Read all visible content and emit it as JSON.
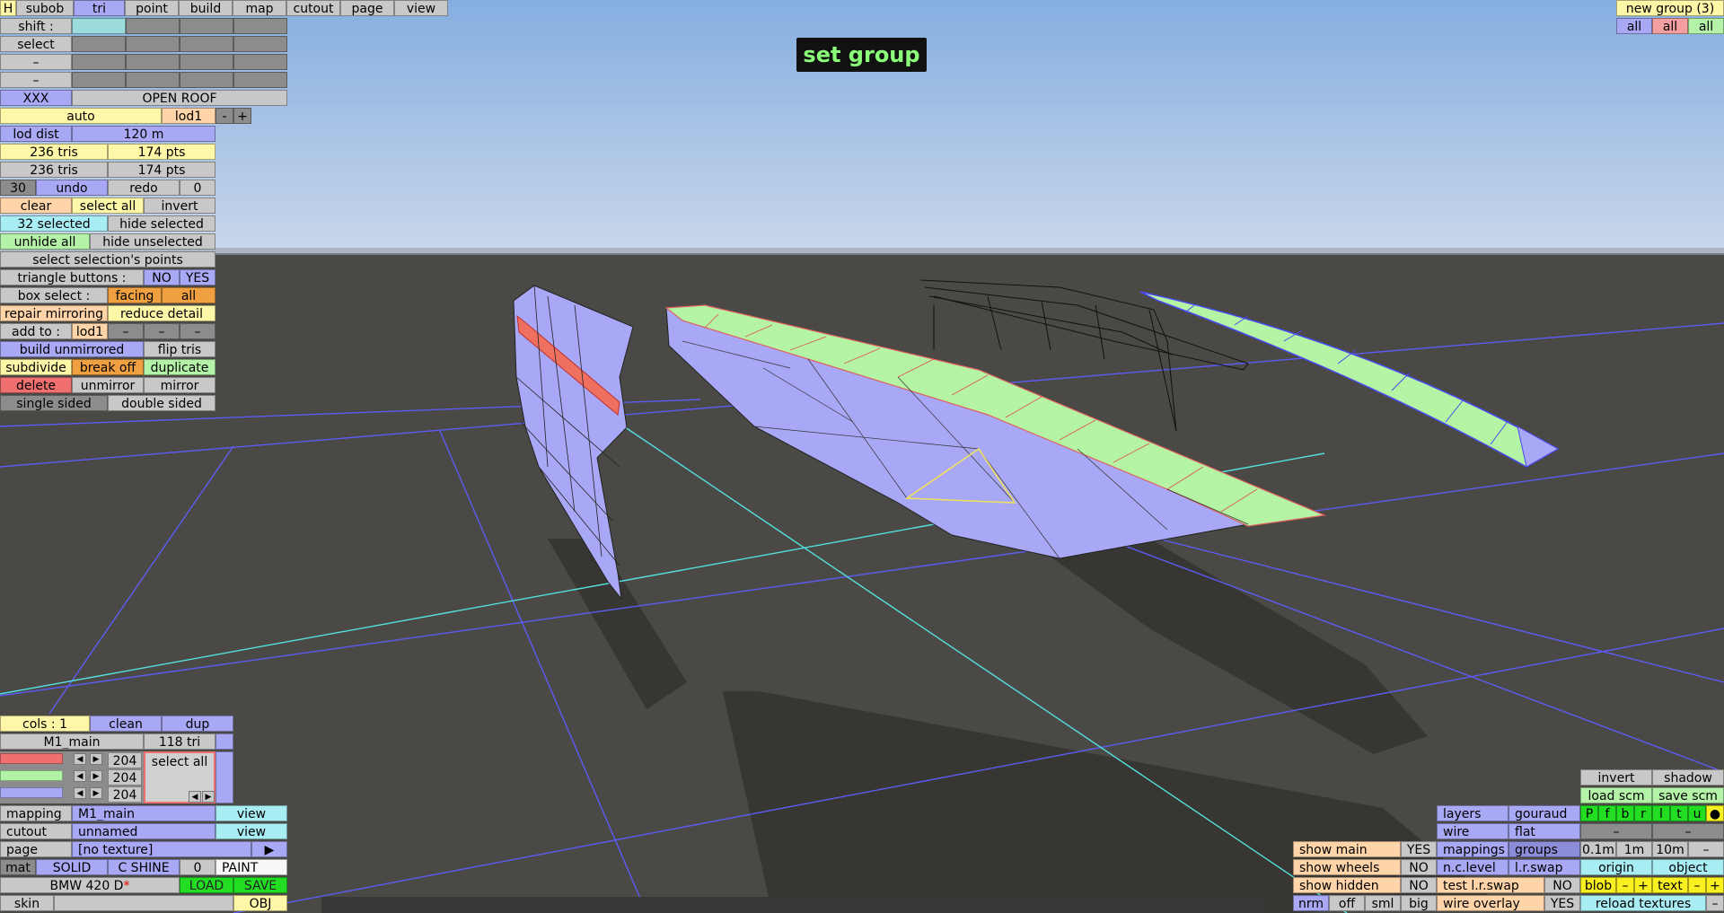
{
  "overlay": {
    "title": "set group"
  },
  "top_tabs": [
    "H",
    "subob",
    "tri",
    "point",
    "build",
    "map",
    "cutout",
    "page",
    "view"
  ],
  "panel": {
    "shift_label": "shift :",
    "select_label": "select",
    "dash": "–",
    "xxx": "XXX",
    "open_roof": "OPEN ROOF",
    "auto": "auto",
    "lod": "lod1",
    "minus": "-",
    "plus": "+",
    "lod_dist_label": "lod dist",
    "lod_dist_value": "120 m",
    "tris1": "236 tris",
    "pts1": "174 pts",
    "tris2": "236 tris",
    "pts2": "174 pts",
    "undo_count": "30",
    "undo": "undo",
    "redo": "redo",
    "redo_count": "0",
    "clear": "clear",
    "select_all": "select all",
    "invert": "invert",
    "selected_count": "32 selected",
    "hide_selected": "hide selected",
    "unhide_all": "unhide all",
    "hide_unselected": "hide unselected",
    "select_points": "select selection's points",
    "triangle_buttons": "triangle buttons :",
    "no": "NO",
    "yes": "YES",
    "box_select": "box select :",
    "facing": "facing",
    "all": "all",
    "repair_mirroring": "repair mirroring",
    "reduce_detail": "reduce detail",
    "add_to": "add to :",
    "add_lod": "lod1",
    "build_unmirrored": "build unmirrored",
    "flip_tris": "flip tris",
    "subdivide": "subdivide",
    "break_off": "break off",
    "duplicate": "duplicate",
    "delete": "delete",
    "unmirror": "unmirror",
    "mirror": "mirror",
    "single_sided": "single sided",
    "double_sided": "double sided"
  },
  "bottom_left": {
    "cols": "cols : 1",
    "clean": "clean",
    "dup": "dup",
    "material": "M1_main",
    "mat_tri": "118 tri",
    "rgb_values": [
      "204",
      "204",
      "204"
    ],
    "select_all": "select all",
    "mapping_label": "mapping",
    "mapping_value": "M1_main",
    "view": "view",
    "cutout_label": "cutout",
    "cutout_value": "unnamed",
    "page_label": "page",
    "page_value": "[no texture]",
    "play": "▶",
    "mat": "mat",
    "solid": "SOLID",
    "c_shine": "C SHINE",
    "shine_value": "0",
    "paint": "PAINT",
    "model_name": "BMW 420 D",
    "modified_mark": "*",
    "load": "LOAD",
    "save": "SAVE",
    "skin": "skin",
    "obj": "OBJ"
  },
  "top_right": {
    "group": "new group (3)",
    "all": [
      "all",
      "all",
      "all"
    ]
  },
  "bottom_right": {
    "show_main": "show main",
    "show_main_v": "YES",
    "show_wheels": "show wheels",
    "show_wheels_v": "NO",
    "show_hidden": "show hidden",
    "show_hidden_v": "NO",
    "nrm": "nrm",
    "off": "off",
    "sml": "sml",
    "big": "big",
    "layers": "layers",
    "gouraud": "gouraud",
    "wire": "wire",
    "flat": "flat",
    "mappings": "mappings",
    "groups": "groups",
    "nc_level": "n.c.level",
    "lr_swap": "l.r.swap",
    "test_lr_swap": "test l.r.swap",
    "test_lr_swap_v": "NO",
    "wire_overlay": "wire overlay",
    "wire_overlay_v": "YES",
    "invert": "invert",
    "shadow": "shadow",
    "load_scm": "load scm",
    "save_scm": "save scm",
    "letters": [
      "P",
      "f",
      "b",
      "r",
      "l",
      "t",
      "u",
      "●"
    ],
    "dash": "–",
    "grid_sizes": [
      "0.1m",
      "1m",
      "10m",
      "–"
    ],
    "origin": "origin",
    "object": "object",
    "blob": "blob",
    "text": "text",
    "minus": "–",
    "plus": "+",
    "reload_textures": "reload textures"
  },
  "colors": {
    "blue": "#a8a8f4",
    "yellow": "#fff7a8",
    "peach": "#ffd4a8",
    "cyan": "#a8ecf4",
    "green": "#b4f2a8",
    "red": "#f07070",
    "orange": "#f0a040",
    "bright_green": "#22dd22",
    "overlay_text": "#8cff7a"
  }
}
